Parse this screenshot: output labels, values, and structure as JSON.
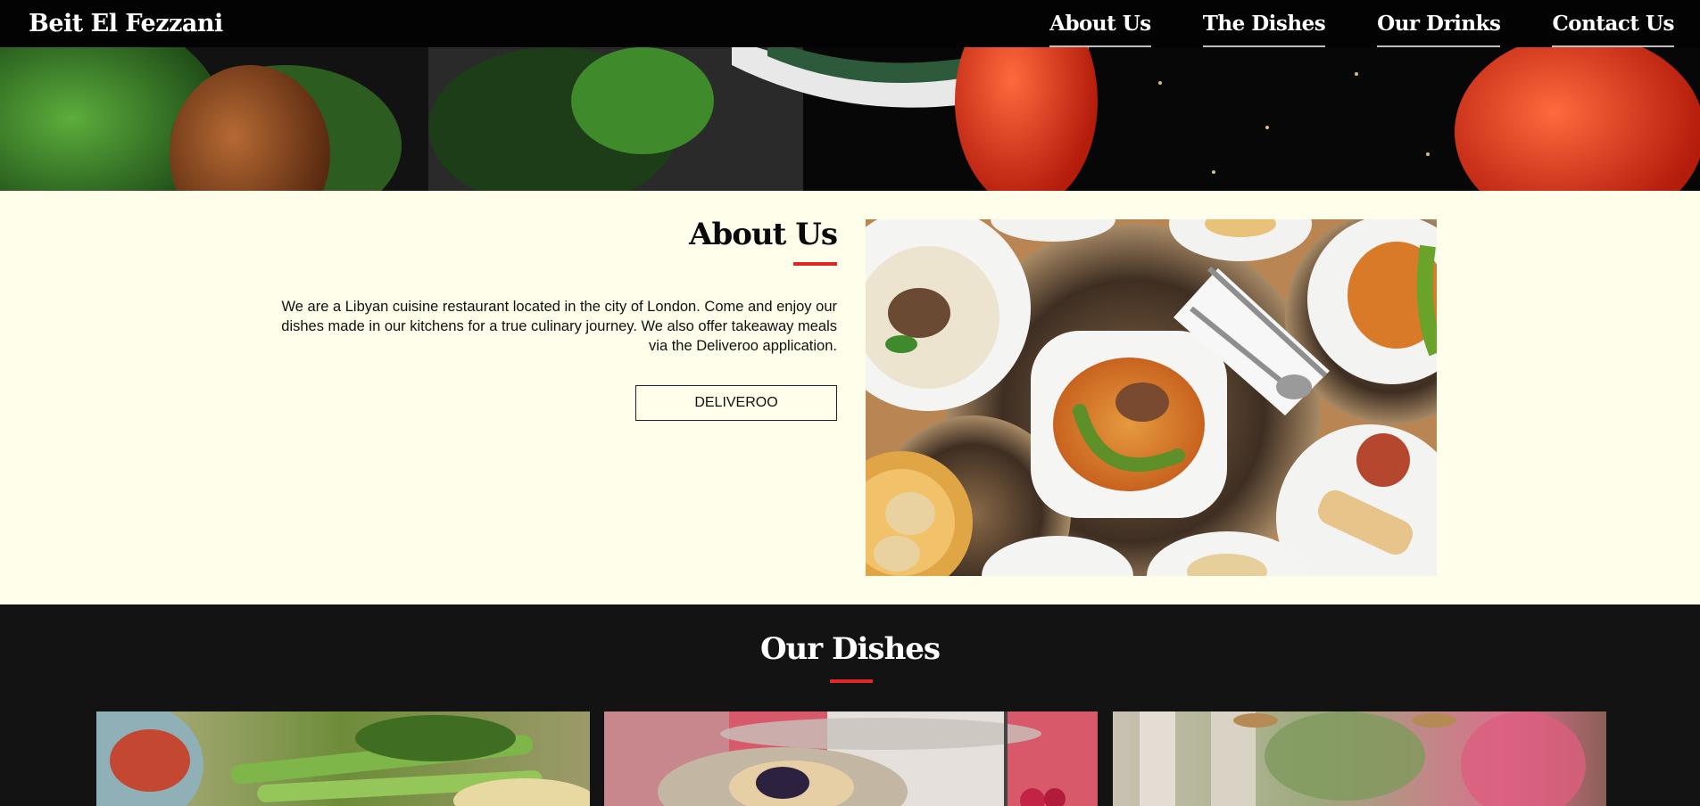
{
  "header": {
    "brand": "Beit El Fezzani",
    "nav": [
      "About Us",
      "The Dishes",
      "Our Drinks",
      "Contact Us"
    ]
  },
  "hero": {
    "image": "food-banner-image"
  },
  "about": {
    "title": "About Us",
    "body": "We are a Libyan cuisine restaurant located in the city of London. Come and enjoy our dishes made in our kitchens for a true culinary journey. We also offer takeaway meals via the Deliveroo application.",
    "button": "DELIVEROO",
    "image": "libyan-dishes-table-photo"
  },
  "dishes": {
    "title": "Our Dishes",
    "cards": [
      "salad-dish-photo",
      "pastry-dessert-photo",
      "restaurant-interior-photo"
    ]
  },
  "colors": {
    "accent": "#e02626",
    "header_bg": "#030303",
    "page_bg": "#fffeeb",
    "dishes_bg": "#131313"
  }
}
